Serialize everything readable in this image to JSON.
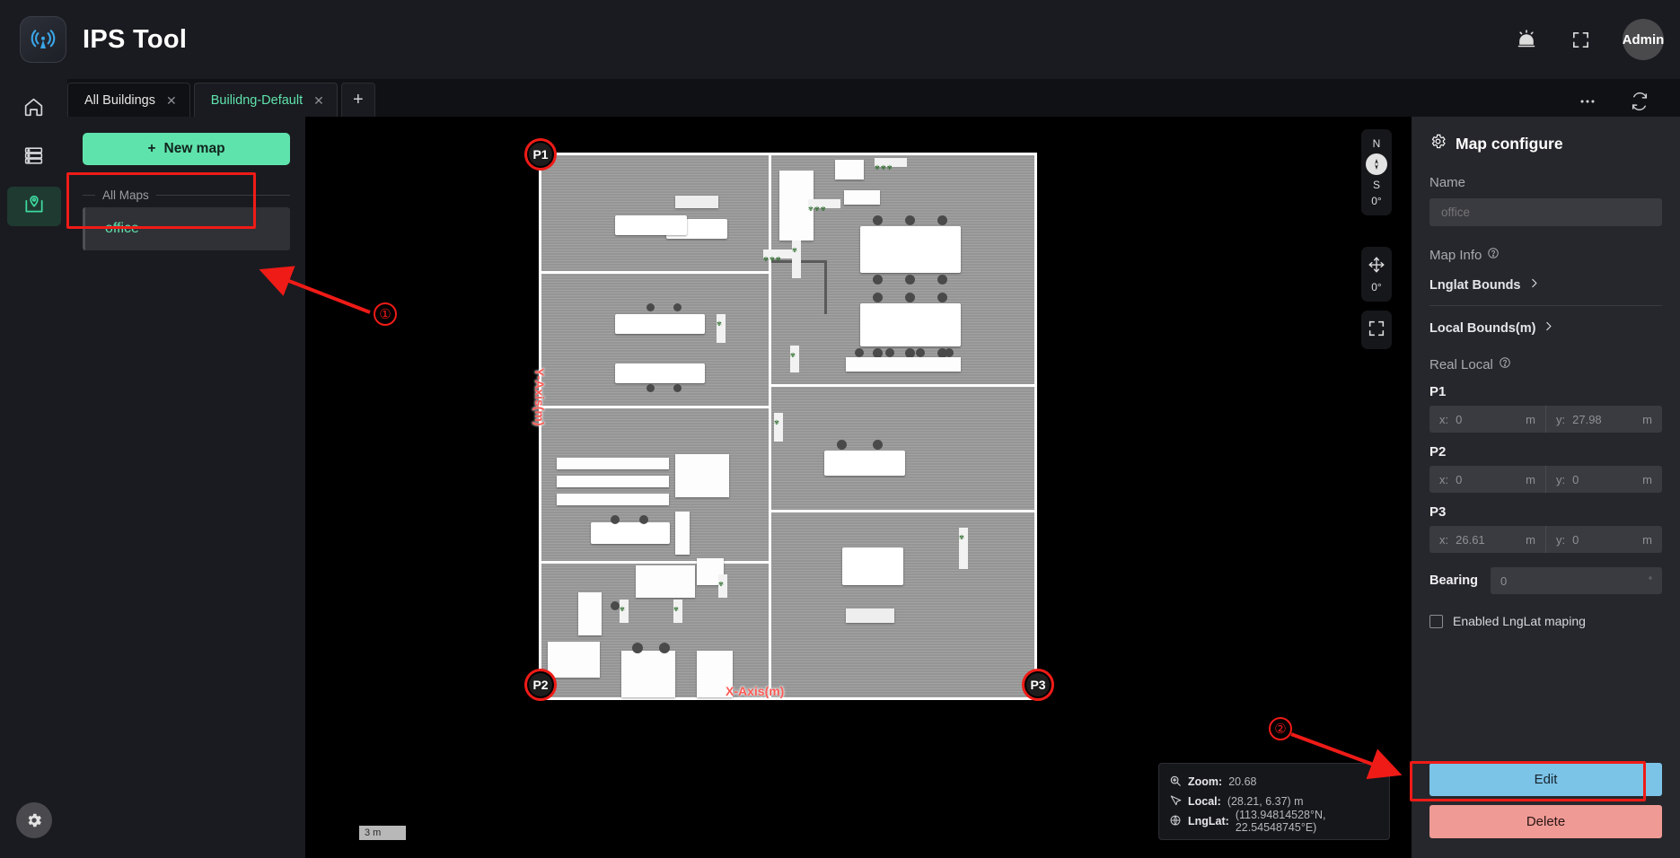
{
  "app": {
    "title": "IPS Tool",
    "logo_icon": "signal-tower-icon"
  },
  "topbar": {
    "alarm_icon": "alarm-bell-icon",
    "fullscreen_icon": "fullscreen-icon",
    "avatar_label": "Admin"
  },
  "rail": {
    "items": [
      {
        "icon": "home-icon",
        "name": "home",
        "active": false
      },
      {
        "icon": "server-list-icon",
        "name": "devices",
        "active": false
      },
      {
        "icon": "map-pin-icon",
        "name": "maps",
        "active": true
      }
    ],
    "settings_icon": "gear-icon"
  },
  "tabs": {
    "items": [
      {
        "label": "All Buildings",
        "active": false
      },
      {
        "label": "Builidng-Default",
        "active": true
      }
    ],
    "add_label": "+",
    "more_icon": "more-horizontal-icon",
    "refresh_icon": "refresh-icon"
  },
  "maplist": {
    "new_map_label": "New map",
    "new_map_plus": "+",
    "section_label": "All Maps",
    "items": [
      {
        "label": "office",
        "selected": true
      }
    ]
  },
  "map": {
    "points": [
      {
        "id": "P1",
        "label": "P1"
      },
      {
        "id": "P2",
        "label": "P2"
      },
      {
        "id": "P3",
        "label": "P3"
      }
    ],
    "axis_x_label": "X-Axis(m)",
    "axis_y_label": "Y-Axis(m)",
    "scalebar_label": "3 m",
    "controls": {
      "compass_north": "N",
      "compass_south": "S",
      "compass_angle": "0°",
      "pan_angle": "0°",
      "pan_icon": "move-arrows-icon",
      "fit_icon": "fit-screen-icon",
      "compass_icon": "compass-needle-icon"
    },
    "info": {
      "zoom_label": "Zoom:",
      "zoom_value": "20.68",
      "zoom_icon": "zoom-in-icon",
      "local_label": "Local:",
      "local_value": "(28.21, 6.37) m",
      "local_icon": "cursor-icon",
      "lnglat_label": "LngLat:",
      "lnglat_value": "(113.94814528°N, 22.54548745°E)",
      "lnglat_icon": "globe-icon"
    }
  },
  "config": {
    "title": "Map configure",
    "title_icon": "gear-icon",
    "name_label": "Name",
    "name_value": "office",
    "name_placeholder": "office",
    "map_info_label": "Map Info",
    "map_info_help_icon": "help-circle-icon",
    "lnglat_bounds_label": "Lnglat Bounds",
    "local_bounds_label": "Local Bounds(m)",
    "real_local_label": "Real Local",
    "real_local_help_icon": "help-circle-icon",
    "chevron_icon": "chevron-right-icon",
    "unit": "m",
    "x_prefix": "x:",
    "y_prefix": "y:",
    "points": [
      {
        "name": "P1",
        "x": "0",
        "y": "27.98"
      },
      {
        "name": "P2",
        "x": "0",
        "y": "0"
      },
      {
        "name": "P3",
        "x": "26.61",
        "y": "0"
      }
    ],
    "bearing_label": "Bearing",
    "bearing_value": "0",
    "bearing_unit": "°",
    "lnglat_maping_label": "Enabled LngLat maping",
    "lnglat_maping_checked": false,
    "edit_label": "Edit",
    "delete_label": "Delete"
  },
  "annotations": [
    {
      "number": "①",
      "target": "office-map-item"
    },
    {
      "number": "②",
      "target": "edit-button"
    }
  ],
  "colors": {
    "accent_green": "#5fe3ad",
    "annotation_red": "#ef1b17",
    "edit_blue": "#7cc3e8",
    "delete_red": "#ef9a95",
    "panel_bg": "#26272c",
    "app_bg": "#17181c"
  }
}
